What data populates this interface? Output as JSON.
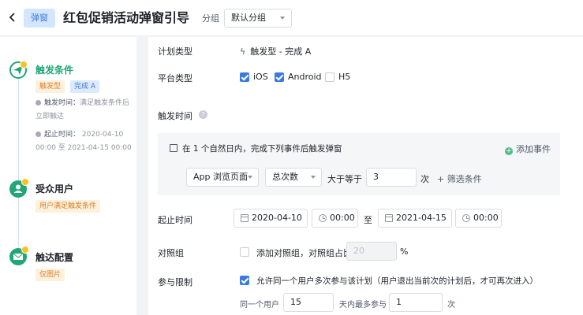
{
  "header": {
    "back_icon": "chevron-left-icon",
    "badge": "弹窗",
    "title": "红包促销活动弹窗引导",
    "edit_icon": "pencil-icon",
    "group_label": "分组",
    "group_value": "默认分组"
  },
  "sidebar": {
    "steps": [
      {
        "title": "触发条件",
        "title_color": "#21a675",
        "icon": "send-icon",
        "tags": [
          "触发型",
          "完成 A"
        ],
        "trigger_label": "触发时间：",
        "trigger_value_line1": "满足触发条件后",
        "trigger_value_line2": "立即触达",
        "period_label": "起止时间：",
        "period_value_line1": "2020-04-10",
        "period_value_line2": "00:00 至 2021-04-15 00:00"
      },
      {
        "title": "受众用户",
        "icon": "user-icon",
        "tags": [
          "用户满足触发条件"
        ]
      },
      {
        "title": "触达配置",
        "icon": "mail-icon",
        "tags": [
          "仅图片"
        ]
      }
    ]
  },
  "form": {
    "plan_type_label": "计划类型",
    "plan_type_value": "触发型 - 完成 A",
    "platform_label": "平台类型",
    "platforms": [
      {
        "label": "iOS",
        "checked": true
      },
      {
        "label": "Android",
        "checked": true
      },
      {
        "label": "H5",
        "checked": false
      }
    ],
    "trigger_time_label": "触发时间",
    "rule": {
      "prefix": "在",
      "count": "1",
      "suffix": "个自然日内，完成下列事件后触发弹窗",
      "add_event": "添加事件",
      "event": "App 浏览页面",
      "metric": "总次数",
      "operator": "大于等于",
      "value": "3",
      "unit": "次",
      "filter": "+ 筛选条件"
    },
    "period_label": "起止时间",
    "start_date": "2020-04-10",
    "start_time": "00:00",
    "to": "至",
    "end_date": "2021-04-15",
    "end_time": "00:00",
    "control_label": "对照组",
    "control_text": "添加对照组，对照组占比",
    "control_placeholder": "20",
    "percent": "%",
    "limit_label": "参与限制",
    "limit_text": "允许同一个用户多次参与该计划（用户退出当前次的计划后，才可再次进入）",
    "same_user_label": "同一个用户",
    "same_user_days": "15",
    "max_label": "天内最多参与",
    "max_value": "1",
    "times_unit": "次"
  },
  "colors": {
    "accent": "#3a7be0",
    "success": "#21a675",
    "warning": "#f7c31e"
  }
}
